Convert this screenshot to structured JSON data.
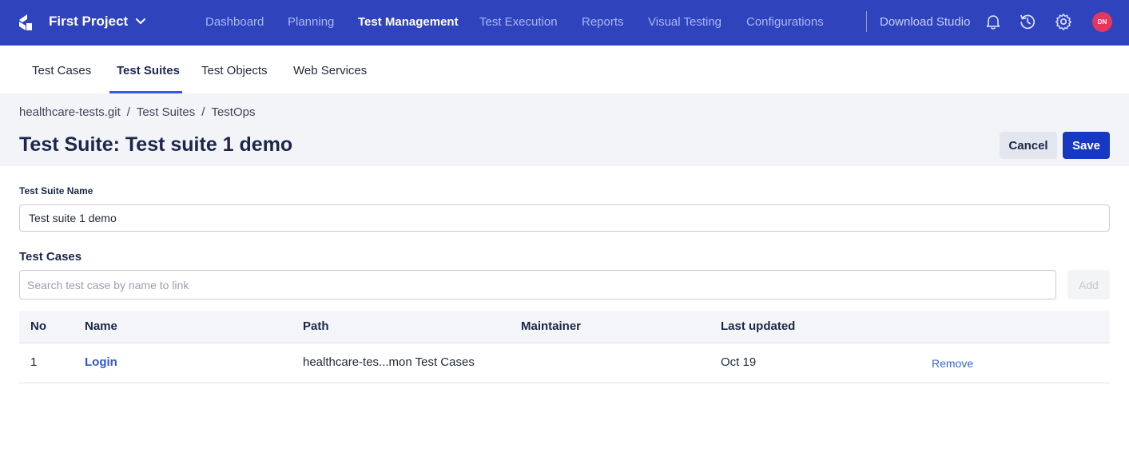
{
  "colors": {
    "topbar_bg": "#2f43bd",
    "primary_button": "#1638c2",
    "link": "#2d56d6",
    "avatar_bg": "#e8355f",
    "active_tab_underline": "#3758e6"
  },
  "topbar": {
    "logo_icon": "katalon-logo-icon",
    "project_name": "First Project",
    "nav": [
      {
        "label": "Dashboard",
        "active": false
      },
      {
        "label": "Planning",
        "active": false
      },
      {
        "label": "Test Management",
        "active": true
      },
      {
        "label": "Test Execution",
        "active": false
      },
      {
        "label": "Reports",
        "active": false
      },
      {
        "label": "Visual Testing",
        "active": false
      },
      {
        "label": "Configurations",
        "active": false
      }
    ],
    "download_studio": "Download Studio",
    "icons": [
      "bell-icon",
      "history-icon",
      "gear-icon"
    ],
    "avatar_initials": "DN"
  },
  "subnav": {
    "tabs": [
      {
        "label": "Test Cases",
        "active": false
      },
      {
        "label": "Test Suites",
        "active": true
      },
      {
        "label": "Test Objects",
        "active": false
      },
      {
        "label": "Web Services",
        "active": false
      }
    ]
  },
  "breadcrumb": [
    "healthcare-tests.git",
    "Test Suites",
    "TestOps"
  ],
  "page_title": "Test Suite: Test suite 1 demo",
  "actions": {
    "cancel": "Cancel",
    "save": "Save"
  },
  "form": {
    "name_label": "Test Suite Name",
    "name_value": "Test suite 1 demo",
    "test_cases_label": "Test Cases",
    "search_placeholder": "Search test case by name to link",
    "add_label": "Add"
  },
  "table": {
    "headers": [
      "No",
      "Name",
      "Path",
      "Maintainer",
      "Last updated"
    ],
    "rows": [
      {
        "no": "1",
        "name": "Login",
        "path": "healthcare-tes...mon Test Cases",
        "maintainer": "",
        "last_updated": "Oct 19",
        "action": "Remove"
      }
    ]
  }
}
